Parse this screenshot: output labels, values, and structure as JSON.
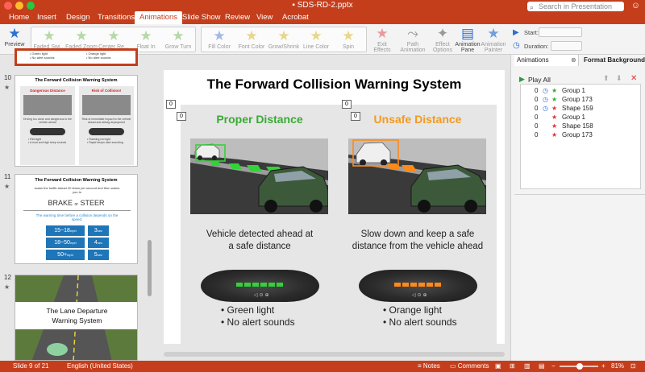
{
  "window": {
    "title": "SDS-RD-2.pptx",
    "search_placeholder": "Search in Presentation"
  },
  "menu": [
    "Home",
    "Insert",
    "Design",
    "Transitions",
    "Animations",
    "Slide Show",
    "Review",
    "View",
    "Acrobat"
  ],
  "menu_active": "Animations",
  "ribbon": {
    "preview": "Preview",
    "entrance_effects": [
      "Faded Swi...",
      "Faded Zoom",
      "Center Re...",
      "Float In",
      "Grow Turn"
    ],
    "emphasis_effects": [
      "Fill Color",
      "Font Color",
      "Grow/Shrink",
      "Line Color",
      "Spin"
    ],
    "exit_effects": "Exit Effects",
    "path_animation": "Path Animation",
    "effect_options": "Effect Options",
    "animation_pane": "Animation Pane",
    "animation_painter": "Animation Painter",
    "start_label": "Start:",
    "duration_label": "Duration:"
  },
  "thumbnails": {
    "slide9_lines": [
      "• Green light",
      "• No alert sounds",
      "• Orange light",
      "• No alert sounds"
    ],
    "slide10": {
      "number": "10",
      "title": "The Forward Collision Warning System",
      "left_head": "Dangerous Distance",
      "right_head": "Risk of Collision!",
      "left_caption": "Driving too close and dangerous to the vehicle ahead",
      "right_caption": "Risk of immediate impact to the vehicle ahead and airbag deployment",
      "left_bullets": [
        "• Red light",
        "• A loud and high beep sounds"
      ],
      "right_bullets": [
        "• Flashing red light",
        "• Rapid beeps start sounding"
      ]
    },
    "slide11": {
      "number": "11",
      "title": "The Forward Collision Warning System",
      "subtitle": "scans the traffic ahead 20 times per second and then warns you to",
      "brake": "BRAKE",
      "or": "or",
      "steer": "STEER",
      "note": "The warning time before a collision depends on the speed:",
      "rows": [
        {
          "speed": "15~18",
          "unit": "mph",
          "time": "3",
          "tunit": "sec"
        },
        {
          "speed": "18~50",
          "unit": "mph",
          "time": "4",
          "tunit": "sec"
        },
        {
          "speed": "50+",
          "unit": "mph",
          "time": "5",
          "tunit": "sec"
        }
      ]
    },
    "slide12": {
      "number": "12",
      "title": "The Lane Departure Warning System"
    }
  },
  "slide": {
    "title": "The Forward Collision Warning System",
    "tags": [
      "0",
      "0",
      "0",
      "0"
    ],
    "left": {
      "heading": "Proper Distance",
      "heading_color": "#3aaa35",
      "caption": "Vehicle detected ahead at a safe distance",
      "bullets": [
        "• Green light",
        "• No alert sounds"
      ],
      "led_color": "#34d13a"
    },
    "right": {
      "heading": "Unsafe Distance",
      "heading_color": "#f39a1e",
      "caption": "Slow down and keep a safe distance from the vehicle ahead",
      "bullets": [
        "• Orange light",
        "• No alert sounds"
      ],
      "led_color": "#ff8a1a"
    }
  },
  "animation_pane": {
    "tabs": [
      "Animations",
      "Format Background"
    ],
    "play_all": "Play All",
    "items": [
      {
        "order": "0",
        "name": "Group 1",
        "star": "green",
        "clock": true
      },
      {
        "order": "0",
        "name": "Group 173",
        "star": "green",
        "clock": true
      },
      {
        "order": "0",
        "name": "Shape 159",
        "star": "red",
        "clock": true
      },
      {
        "order": "0",
        "name": "Group 1",
        "star": "red",
        "clock": false
      },
      {
        "order": "0",
        "name": "Shape 158",
        "star": "red",
        "clock": false
      },
      {
        "order": "0",
        "name": "Group 173",
        "star": "red",
        "clock": false
      }
    ]
  },
  "statusbar": {
    "slide": "Slide 9 of 21",
    "language": "English (United States)",
    "notes": "Notes",
    "comments": "Comments",
    "zoom": "81%"
  }
}
